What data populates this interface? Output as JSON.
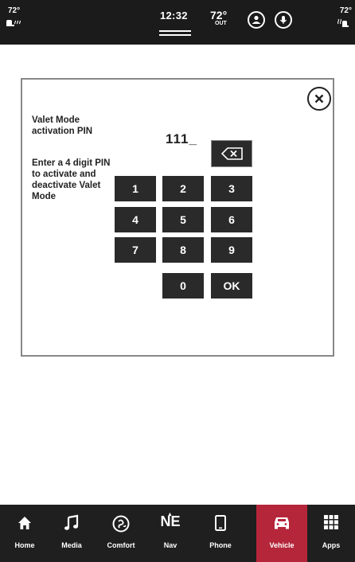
{
  "status_bar": {
    "left_temp": "72°",
    "right_temp": "72°",
    "clock": "12:32",
    "outside_temp": "72°",
    "outside_label": "OUT",
    "icons": [
      "heated-seat-icon",
      "clock-menu-icon",
      "profile-icon",
      "microphone-icon",
      "heated-seat-icon"
    ]
  },
  "modal": {
    "title": "Valet Mode activation PIN",
    "instructions": "Enter a 4 digit PIN to activate and deactivate Valet Mode",
    "pin_value": "111_",
    "close_icon": "close-icon",
    "backspace_icon": "backspace-icon",
    "keys": [
      "1",
      "2",
      "3",
      "4",
      "5",
      "6",
      "7",
      "8",
      "9",
      "0",
      "OK"
    ]
  },
  "bottom_nav": {
    "items": [
      {
        "label": "Home",
        "icon": "home-icon"
      },
      {
        "label": "Media",
        "icon": "music-note-icon"
      },
      {
        "label": "Comfort",
        "icon": "comfort-icon"
      },
      {
        "label": "Nav",
        "icon": "compass-icon",
        "heading": "NE"
      },
      {
        "label": "Phone",
        "icon": "phone-icon"
      },
      {
        "label": "Vehicle",
        "icon": "car-icon"
      },
      {
        "label": "Apps",
        "icon": "apps-grid-icon"
      }
    ],
    "active": "Vehicle",
    "active_color": "#b5263a"
  },
  "colors": {
    "status_bar_bg": "#1b1b1b",
    "nav_bg": "#1f1f1f",
    "key_bg": "#2a2a2a",
    "modal_border": "#888888"
  }
}
